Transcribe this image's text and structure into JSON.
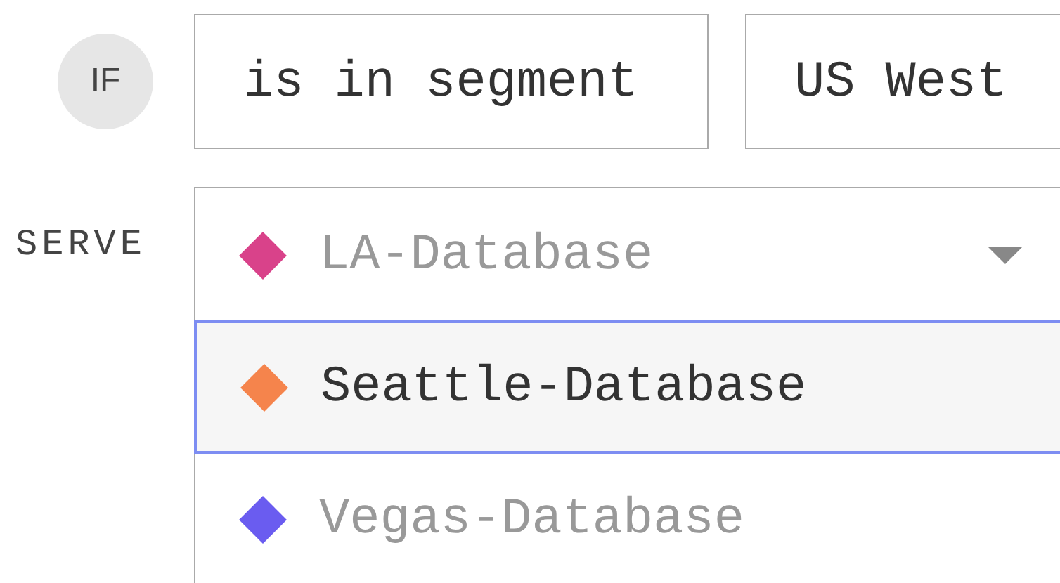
{
  "condition": {
    "label": "IF",
    "operator": "is in segment",
    "segment": "US West"
  },
  "serve": {
    "label": "SERVE",
    "value": {
      "name": "LA-Database",
      "color": "#d9428a"
    },
    "expanded": true,
    "options": [
      {
        "name": "Seattle-Database",
        "color": "#f5844c",
        "selected": true
      },
      {
        "name": "Vegas-Database",
        "color": "#6a5cf0",
        "selected": false
      }
    ]
  }
}
